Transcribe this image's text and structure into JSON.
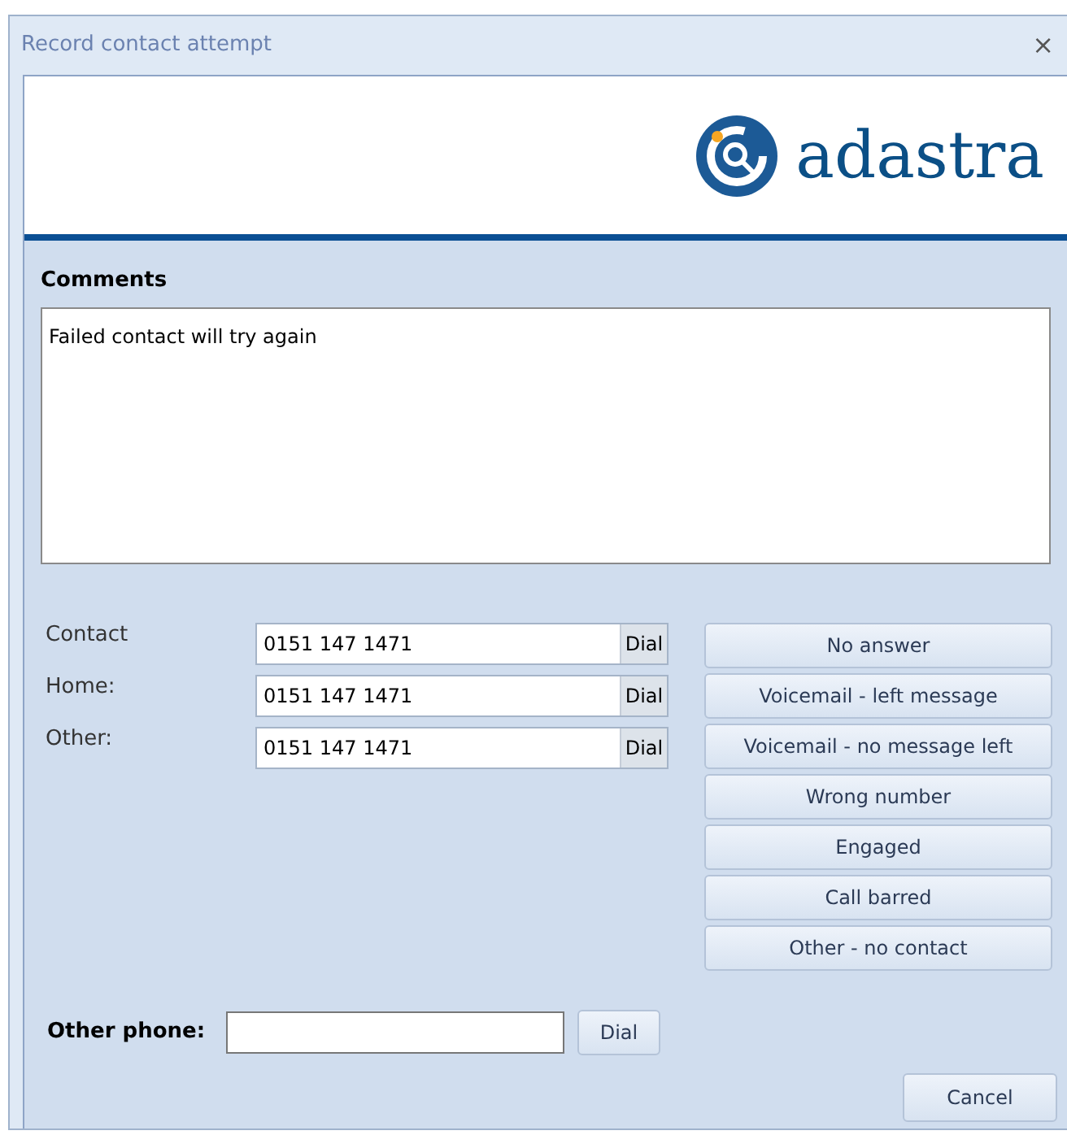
{
  "window": {
    "title": "Record contact attempt",
    "close": "×"
  },
  "logo": {
    "text": "adastra"
  },
  "comments": {
    "label": "Comments",
    "value": "Failed contact will try again"
  },
  "phones": [
    {
      "label": "Contact",
      "value": "0151 147 1471",
      "button": "Dial"
    },
    {
      "label": "Home:",
      "value": "0151 147 1471",
      "button": "Dial"
    },
    {
      "label": "Other:",
      "value": "0151 147 1471",
      "button": "Dial"
    }
  ],
  "outcomes": [
    "No answer",
    "Voicemail - left message",
    "Voicemail - no message left",
    "Wrong number",
    "Engaged",
    "Call barred",
    "Other - no contact"
  ],
  "other_phone": {
    "label": "Other phone:",
    "button": "Dial"
  },
  "cancel": "Cancel"
}
